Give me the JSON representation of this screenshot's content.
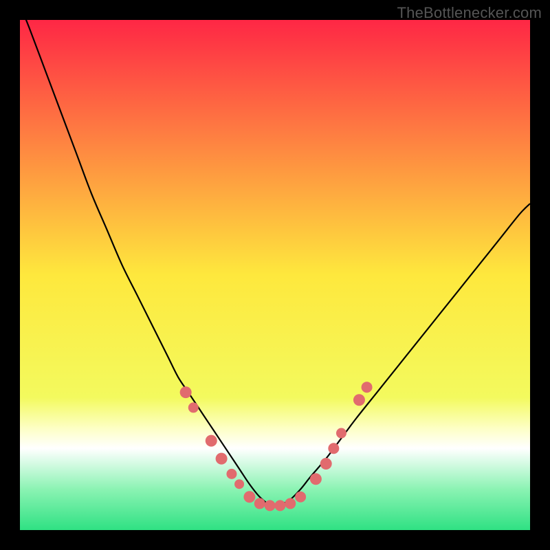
{
  "attribution": "TheBottlenecker.com",
  "chart_data": {
    "type": "line",
    "title": "",
    "xlabel": "",
    "ylabel": "",
    "xlim": [
      0,
      100
    ],
    "ylim": [
      0,
      100
    ],
    "grid": false,
    "legend": false,
    "background_gradient": [
      {
        "offset": 0.0,
        "color": "#fe2745"
      },
      {
        "offset": 0.5,
        "color": "#fee83d"
      },
      {
        "offset": 0.74,
        "color": "#f3fa5e"
      },
      {
        "offset": 0.8,
        "color": "#fdffc4"
      },
      {
        "offset": 0.84,
        "color": "#ffffff"
      },
      {
        "offset": 0.92,
        "color": "#8bf3b3"
      },
      {
        "offset": 1.0,
        "color": "#2fe183"
      }
    ],
    "series": [
      {
        "name": "bottleneck-curve",
        "color": "#000000",
        "x": [
          0,
          2,
          5,
          8,
          11,
          14,
          17,
          20,
          23,
          26,
          29,
          31,
          33,
          35,
          37,
          39,
          41,
          43,
          45,
          47,
          49,
          51,
          53,
          55,
          57,
          60,
          63,
          66,
          70,
          74,
          78,
          82,
          86,
          90,
          94,
          98,
          100
        ],
        "y": [
          103,
          98,
          90,
          82,
          74,
          66,
          59,
          52,
          46,
          40,
          34,
          30,
          27,
          24,
          21,
          18,
          15,
          12,
          9,
          6.5,
          5,
          5,
          6,
          8,
          10.5,
          14,
          18,
          22,
          27,
          32,
          37,
          42,
          47,
          52,
          57,
          62,
          64
        ]
      }
    ],
    "markers": [
      {
        "x": 32.5,
        "y": 27,
        "r": 8.5
      },
      {
        "x": 34.0,
        "y": 24,
        "r": 7.5
      },
      {
        "x": 37.5,
        "y": 17.5,
        "r": 8.5
      },
      {
        "x": 39.5,
        "y": 14,
        "r": 8.5
      },
      {
        "x": 41.5,
        "y": 11,
        "r": 7.5
      },
      {
        "x": 43.0,
        "y": 9,
        "r": 7.0
      },
      {
        "x": 45.0,
        "y": 6.5,
        "r": 8.5
      },
      {
        "x": 47.0,
        "y": 5.2,
        "r": 8.0
      },
      {
        "x": 49.0,
        "y": 4.8,
        "r": 8.0
      },
      {
        "x": 51.0,
        "y": 4.8,
        "r": 8.0
      },
      {
        "x": 53.0,
        "y": 5.2,
        "r": 8.0
      },
      {
        "x": 55.0,
        "y": 6.5,
        "r": 8.0
      },
      {
        "x": 58.0,
        "y": 10,
        "r": 8.5
      },
      {
        "x": 60.0,
        "y": 13,
        "r": 8.5
      },
      {
        "x": 61.5,
        "y": 16,
        "r": 8.0
      },
      {
        "x": 63.0,
        "y": 19,
        "r": 7.5
      },
      {
        "x": 66.5,
        "y": 25.5,
        "r": 8.5
      },
      {
        "x": 68.0,
        "y": 28,
        "r": 8.0
      }
    ],
    "marker_color": "#e16b6e"
  }
}
